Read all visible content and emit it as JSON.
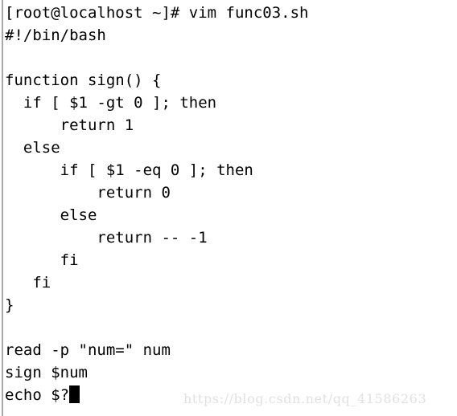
{
  "terminal": {
    "background_color": "#ffffff",
    "text_color": "#000000",
    "left_rule_color": "#a9a9a9",
    "cursor_color": "#000000",
    "prompt_line": "[root@localhost ~]# vim func03.sh",
    "lines": [
      "[root@localhost ~]# vim func03.sh",
      "#!/bin/bash",
      "",
      "function sign() {",
      "  if [ $1 -gt 0 ]; then",
      "      return 1",
      "  else",
      "      if [ $1 -eq 0 ]; then",
      "          return 0",
      "      else",
      "          return -- -1",
      "      fi",
      "   fi",
      "}",
      "",
      "read -p \"num=\" num",
      "sign $num",
      "echo $?"
    ],
    "cursor": {
      "name": "block-cursor",
      "line_index": 17,
      "after_text": "echo $?"
    }
  },
  "watermark": {
    "text": "https://blog.csdn.net/qq_41586263",
    "color": "#e3e1df"
  }
}
